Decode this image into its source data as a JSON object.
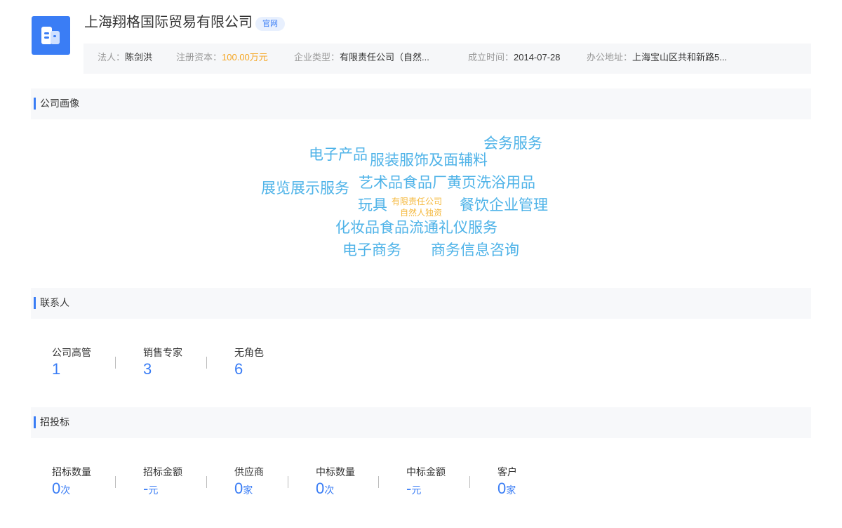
{
  "header": {
    "logo_icon": "building-icon",
    "company_name": "上海翔格国际贸易有限公司",
    "badge": "官网",
    "info": [
      {
        "label": "法人：",
        "value": "陈剑洪"
      },
      {
        "label": "注册资本：",
        "value": "100.00万元",
        "color": "#f5a623"
      },
      {
        "label": "企业类型：",
        "value": "有限责任公司（自然..."
      },
      {
        "label": "成立时间：",
        "value": "2014-07-28"
      },
      {
        "label": "办公地址：",
        "value": "上海宝山区共和新路5..."
      }
    ]
  },
  "portrait": {
    "title": "公司画像",
    "words": [
      "电子产品",
      "服装服饰及面辅料",
      "会务服务",
      "展览展示服务",
      "艺术品食品厂黄页洗浴用品",
      "玩具",
      "餐饮企业管理",
      "化妆品食品流通礼仪服务",
      "电子商务",
      "商务信息咨询"
    ],
    "center_lines": [
      "有限责任公司",
      "自然人独资"
    ],
    "word_color": "#4fb3e8",
    "center_color": "#f5b83c"
  },
  "contacts": {
    "title": "联系人",
    "stats": [
      {
        "label": "公司高管",
        "value": "1"
      },
      {
        "label": "销售专家",
        "value": "3"
      },
      {
        "label": "无角色",
        "value": "6"
      }
    ]
  },
  "bidding": {
    "title": "招投标",
    "stats": [
      {
        "label": "招标数量",
        "value": "0",
        "unit": "次"
      },
      {
        "label": "招标金额",
        "value": "-",
        "unit": "元"
      },
      {
        "label": "供应商",
        "value": "0",
        "unit": "家"
      },
      {
        "label": "中标数量",
        "value": "0",
        "unit": "次"
      },
      {
        "label": "中标金额",
        "value": "-",
        "unit": "元"
      },
      {
        "label": "客户",
        "value": "0",
        "unit": "家"
      }
    ]
  },
  "accent_color": "#3a7df5"
}
